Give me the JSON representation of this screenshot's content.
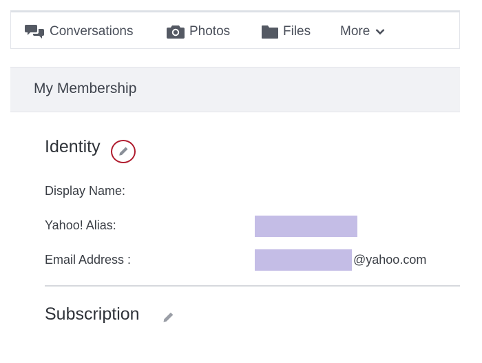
{
  "nav": {
    "items": [
      {
        "label": "Conversations",
        "icon": "chat-bubbles-icon"
      },
      {
        "label": "Photos",
        "icon": "camera-icon"
      },
      {
        "label": "Files",
        "icon": "folder-icon"
      },
      {
        "label": "More",
        "icon": "chevron-down-icon"
      }
    ]
  },
  "membership": {
    "title": "My Membership"
  },
  "identity": {
    "title": "Identity",
    "fields": [
      {
        "label": "Display Name:",
        "value": ""
      },
      {
        "label": "Yahoo! Alias:",
        "value": ""
      },
      {
        "label": "Email Address :",
        "value": "",
        "suffix": "@yahoo.com"
      }
    ]
  },
  "subscription": {
    "title": "Subscription"
  },
  "colors": {
    "redaction": "#c4bde6",
    "highlight_ring": "#b01c2e",
    "bar_background": "#f1f2f5"
  }
}
